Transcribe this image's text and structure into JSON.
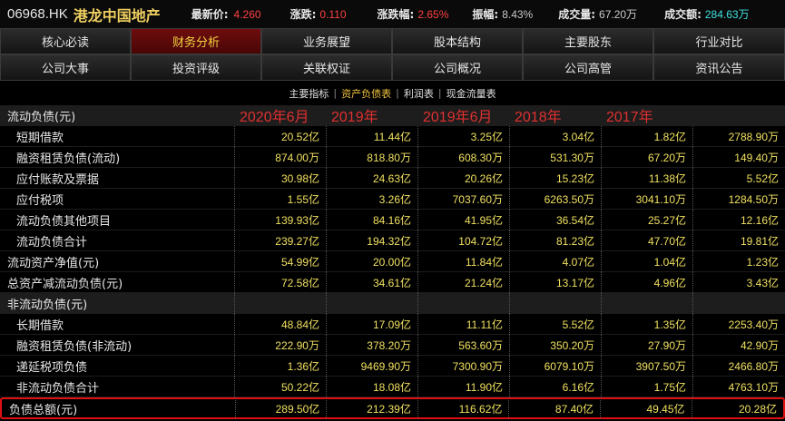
{
  "quote": {
    "code": "06968.HK",
    "name": "港龙中国地产",
    "last_price_label": "最新价:",
    "last_price": "4.260",
    "change_label": "涨跌:",
    "change": "0.110",
    "change_pct_label": "涨跌幅:",
    "change_pct": "2.65%",
    "amplitude_label": "振幅:",
    "amplitude": "8.43%",
    "volume_label": "成交量:",
    "volume": "67.20万",
    "turnover_label": "成交额:",
    "turnover": "284.63万"
  },
  "nav": {
    "row1": [
      "核心必读",
      "财务分析",
      "业务展望",
      "股本结构",
      "主要股东",
      "行业对比"
    ],
    "row2": [
      "公司大事",
      "投资评级",
      "关联权证",
      "公司概况",
      "公司高管",
      "资讯公告"
    ]
  },
  "subtabs": {
    "items": [
      "主要指标",
      "资产负债表",
      "利润表",
      "现金流量表"
    ],
    "separator": "|"
  },
  "years": [
    "2020年6月",
    "2019年",
    "2019年6月",
    "2018年",
    "2017年"
  ],
  "table": {
    "header_label": "流动负债(元)",
    "rows": [
      {
        "label": "短期借款",
        "values": [
          "20.52亿",
          "11.44亿",
          "3.25亿",
          "3.04亿",
          "1.82亿",
          "2788.90万"
        ]
      },
      {
        "label": "融资租赁负债(流动)",
        "values": [
          "874.00万",
          "818.80万",
          "608.30万",
          "531.30万",
          "67.20万",
          "149.40万"
        ]
      },
      {
        "label": "应付账款及票据",
        "values": [
          "30.98亿",
          "24.63亿",
          "20.26亿",
          "15.23亿",
          "11.38亿",
          "5.52亿"
        ]
      },
      {
        "label": "应付税项",
        "values": [
          "1.55亿",
          "3.26亿",
          "7037.60万",
          "6263.50万",
          "3041.10万",
          "1284.50万"
        ]
      },
      {
        "label": "流动负债其他项目",
        "values": [
          "139.93亿",
          "84.16亿",
          "41.95亿",
          "36.54亿",
          "25.27亿",
          "12.16亿"
        ]
      },
      {
        "label": "流动负债合计",
        "values": [
          "239.27亿",
          "194.32亿",
          "104.72亿",
          "81.23亿",
          "47.70亿",
          "19.81亿"
        ]
      },
      {
        "label": "流动资产净值(元)",
        "values": [
          "54.99亿",
          "20.00亿",
          "11.84亿",
          "4.07亿",
          "1.04亿",
          "1.23亿"
        ]
      },
      {
        "label": "总资产减流动负债(元)",
        "values": [
          "72.58亿",
          "34.61亿",
          "21.24亿",
          "13.17亿",
          "4.96亿",
          "3.43亿"
        ]
      },
      {
        "label": "非流动负债(元)",
        "values": [
          "",
          "",
          "",
          "",
          "",
          ""
        ]
      },
      {
        "label": "长期借款",
        "values": [
          "48.84亿",
          "17.09亿",
          "11.11亿",
          "5.52亿",
          "1.35亿",
          "2253.40万"
        ]
      },
      {
        "label": "融资租赁负债(非流动)",
        "values": [
          "222.90万",
          "378.20万",
          "563.60万",
          "350.20万",
          "27.90万",
          "42.90万"
        ]
      },
      {
        "label": "递延税项负债",
        "values": [
          "1.36亿",
          "9469.90万",
          "7300.90万",
          "6079.10万",
          "3907.50万",
          "2466.80万"
        ]
      },
      {
        "label": "非流动负债合计",
        "values": [
          "50.22亿",
          "18.08亿",
          "11.90亿",
          "6.16亿",
          "1.75亿",
          "4763.10万"
        ]
      },
      {
        "label": "负债总额(元)",
        "values": [
          "289.50亿",
          "212.39亿",
          "116.62亿",
          "87.40亿",
          "49.45亿",
          "20.28亿"
        ]
      }
    ]
  }
}
